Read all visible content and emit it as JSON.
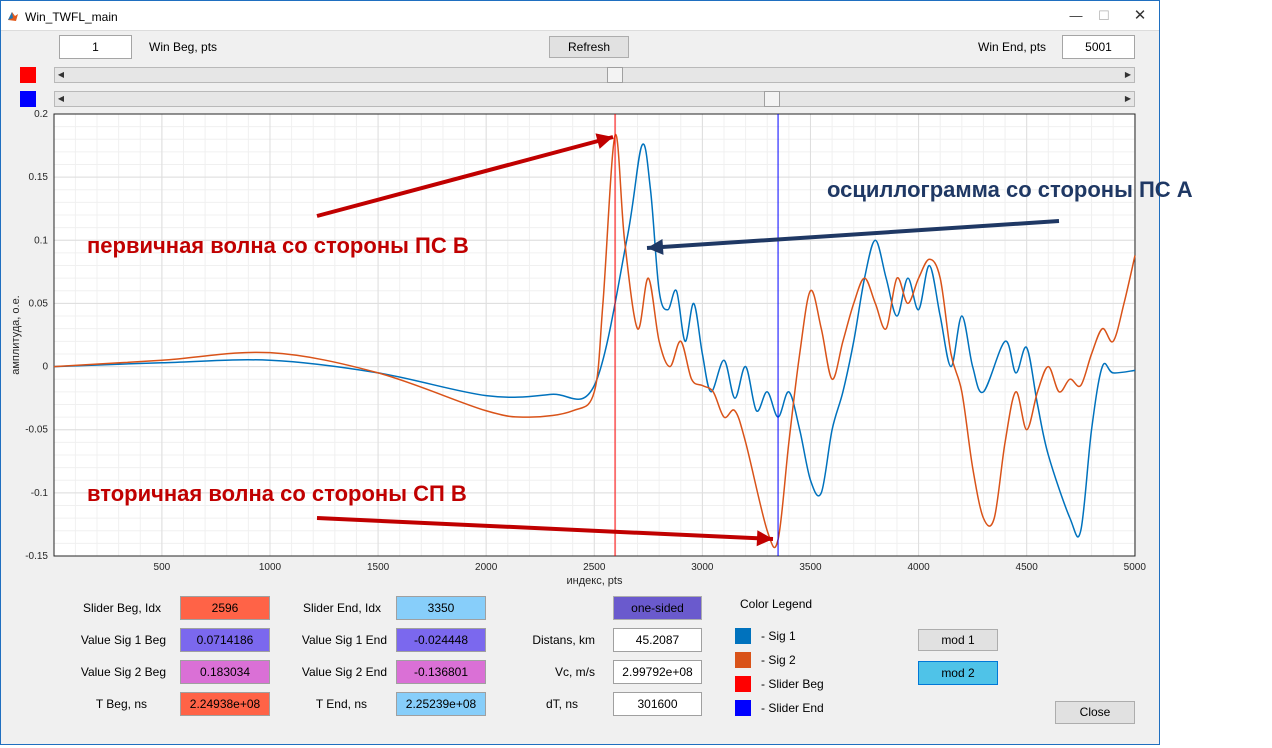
{
  "window": {
    "title": "Win_TWFL_main"
  },
  "controls": {
    "win_beg_value": "1",
    "win_beg_label": "Win Beg, pts",
    "refresh_label": "Refresh",
    "win_end_label": "Win End, pts",
    "win_end_value": "5001"
  },
  "sliders": {
    "slider1_color": "#ff0000",
    "slider2_color": "#0000ff",
    "slider1_value": 2596,
    "slider2_value": 3350,
    "max": 5001
  },
  "chart_data": {
    "type": "line",
    "xlabel": "индекс, pts",
    "ylabel": "амплитуда, о.е.",
    "xlim": [
      1,
      5001
    ],
    "ylim": [
      -0.15,
      0.2
    ],
    "xticks": [
      500,
      1000,
      1500,
      2000,
      2500,
      3000,
      3500,
      4000,
      4500,
      5000
    ],
    "yticks": [
      -0.15,
      -0.1,
      -0.05,
      0,
      0.05,
      0.1,
      0.15,
      0.2
    ],
    "ytick_labels": [
      "-0.15",
      "-0.1",
      "-0.05",
      "0",
      "0.05",
      "0.1",
      "0.15",
      "0.2"
    ],
    "grid": true,
    "series": [
      {
        "color": "#0072bd",
        "points": [
          [
            1,
            0
          ],
          [
            500,
            0.003
          ],
          [
            1000,
            0.005
          ],
          [
            1500,
            -0.005
          ],
          [
            2000,
            -0.023
          ],
          [
            2300,
            -0.022
          ],
          [
            2500,
            -0.015
          ],
          [
            2650,
            0.1
          ],
          [
            2720,
            0.175
          ],
          [
            2760,
            0.14
          ],
          [
            2800,
            0.06
          ],
          [
            2840,
            0.045
          ],
          [
            2880,
            0.06
          ],
          [
            2920,
            0.02
          ],
          [
            2960,
            0.05
          ],
          [
            3000,
            0.01
          ],
          [
            3040,
            -0.02
          ],
          [
            3100,
            0.005
          ],
          [
            3150,
            -0.025
          ],
          [
            3200,
            0.0
          ],
          [
            3250,
            -0.035
          ],
          [
            3300,
            -0.02
          ],
          [
            3350,
            -0.04
          ],
          [
            3400,
            -0.02
          ],
          [
            3450,
            -0.05
          ],
          [
            3500,
            -0.09
          ],
          [
            3550,
            -0.1
          ],
          [
            3600,
            -0.05
          ],
          [
            3650,
            -0.02
          ],
          [
            3700,
            0.02
          ],
          [
            3750,
            0.07
          ],
          [
            3800,
            0.1
          ],
          [
            3850,
            0.07
          ],
          [
            3900,
            0.04
          ],
          [
            3950,
            0.07
          ],
          [
            4000,
            0.045
          ],
          [
            4050,
            0.08
          ],
          [
            4100,
            0.04
          ],
          [
            4150,
            0.0
          ],
          [
            4200,
            0.04
          ],
          [
            4250,
            0.0
          ],
          [
            4300,
            -0.02
          ],
          [
            4400,
            0.02
          ],
          [
            4450,
            -0.005
          ],
          [
            4500,
            0.015
          ],
          [
            4550,
            -0.03
          ],
          [
            4600,
            -0.07
          ],
          [
            4700,
            -0.12
          ],
          [
            4750,
            -0.13
          ],
          [
            4800,
            -0.05
          ],
          [
            4850,
            0.0
          ],
          [
            4900,
            -0.005
          ],
          [
            5001,
            -0.003
          ]
        ]
      },
      {
        "color": "#d95319",
        "points": [
          [
            1,
            0
          ],
          [
            500,
            0.005
          ],
          [
            1000,
            0.011
          ],
          [
            1500,
            -0.005
          ],
          [
            2000,
            -0.035
          ],
          [
            2200,
            -0.04
          ],
          [
            2400,
            -0.035
          ],
          [
            2500,
            -0.02
          ],
          [
            2540,
            0.05
          ],
          [
            2596,
            0.183
          ],
          [
            2640,
            0.1
          ],
          [
            2700,
            0.03
          ],
          [
            2750,
            0.07
          ],
          [
            2800,
            0.02
          ],
          [
            2850,
            0.0
          ],
          [
            2900,
            0.02
          ],
          [
            2950,
            -0.01
          ],
          [
            3000,
            -0.015
          ],
          [
            3050,
            -0.02
          ],
          [
            3100,
            -0.04
          ],
          [
            3150,
            -0.035
          ],
          [
            3200,
            -0.06
          ],
          [
            3300,
            -0.13
          ],
          [
            3350,
            -0.137
          ],
          [
            3400,
            -0.06
          ],
          [
            3450,
            0.01
          ],
          [
            3500,
            0.06
          ],
          [
            3550,
            0.03
          ],
          [
            3600,
            -0.01
          ],
          [
            3650,
            0.02
          ],
          [
            3700,
            0.05
          ],
          [
            3750,
            0.07
          ],
          [
            3800,
            0.05
          ],
          [
            3850,
            0.03
          ],
          [
            3900,
            0.07
          ],
          [
            3950,
            0.05
          ],
          [
            4000,
            0.07
          ],
          [
            4050,
            0.085
          ],
          [
            4100,
            0.07
          ],
          [
            4150,
            0.01
          ],
          [
            4200,
            -0.02
          ],
          [
            4250,
            -0.08
          ],
          [
            4300,
            -0.12
          ],
          [
            4350,
            -0.12
          ],
          [
            4400,
            -0.06
          ],
          [
            4450,
            -0.02
          ],
          [
            4500,
            -0.05
          ],
          [
            4550,
            -0.02
          ],
          [
            4600,
            0.0
          ],
          [
            4650,
            -0.02
          ],
          [
            4700,
            -0.01
          ],
          [
            4750,
            -0.015
          ],
          [
            4800,
            0.01
          ],
          [
            4850,
            0.03
          ],
          [
            4900,
            0.02
          ],
          [
            4950,
            0.05
          ],
          [
            5001,
            0.088
          ]
        ]
      }
    ],
    "markers": [
      {
        "x": 2596,
        "color": "#ff0000"
      },
      {
        "x": 3350,
        "color": "#0000ff"
      }
    ]
  },
  "annotations": {
    "primary_wave": "первичная волна со стороны ПС В",
    "oscillogram": "осциллограмма со стороны ПС А",
    "secondary_wave": "вторичная волна со стороны СП В",
    "primary_color": "#c00000",
    "oscillogram_color": "#1f3864",
    "secondary_color": "#c00000"
  },
  "fields": {
    "slider_beg_label": "Slider Beg, Idx",
    "slider_beg_value": "2596",
    "slider_end_label": "Slider End, Idx",
    "slider_end_value": "3350",
    "one_sided_label": "one-sided",
    "value_sig1_beg_label": "Value Sig 1 Beg",
    "value_sig1_beg_value": "0.0714186",
    "value_sig1_end_label": "Value Sig 1 End",
    "value_sig1_end_value": "-0.024448",
    "distans_label": "Distans, km",
    "distans_value": "45.2087",
    "value_sig2_beg_label": "Value Sig 2 Beg",
    "value_sig2_beg_value": "0.183034",
    "value_sig2_end_label": "Value Sig 2 End",
    "value_sig2_end_value": "-0.136801",
    "vc_label": "Vc, m/s",
    "vc_value": "2.99792e+08",
    "t_beg_label": "T Beg, ns",
    "t_beg_value": "2.24938e+08",
    "t_end_label": "T End, ns",
    "t_end_value": "2.25239e+08",
    "dt_label": "dT, ns",
    "dt_value": "301600"
  },
  "legend": {
    "title": "Color Legend",
    "items": [
      {
        "label": "- Sig 1",
        "color": "#0072bd"
      },
      {
        "label": "- Sig 2",
        "color": "#d95319"
      },
      {
        "label": "- Slider Beg",
        "color": "#ff0000"
      },
      {
        "label": "- Slider End",
        "color": "#0000ff"
      }
    ]
  },
  "buttons": {
    "mod1_label": "mod 1",
    "mod2_label": "mod 2",
    "close_label": "Close"
  },
  "colors": {
    "slider_beg_bg": "#ff6347",
    "slider_end_bg": "#87cefa",
    "sig1_beg_bg": "#7b68ee",
    "sig1_end_bg": "#7b68ee",
    "sig2_beg_bg": "#da70d6",
    "sig2_end_bg": "#da70d6",
    "t_beg_bg": "#ff6347",
    "t_end_bg": "#87cefa",
    "one_sided_bg": "#6a5acd",
    "mod2_bg": "#4fc3e8"
  }
}
